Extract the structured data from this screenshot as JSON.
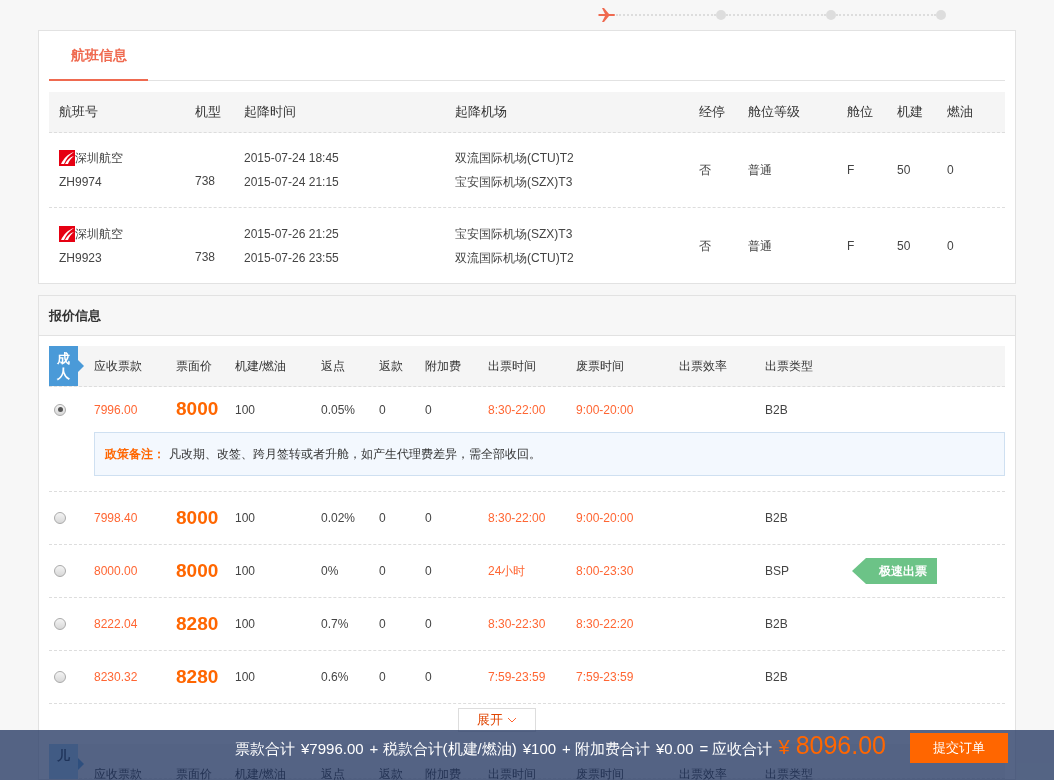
{
  "steps": [
    {
      "kind": "plane",
      "selected": true
    },
    {
      "kind": "dot",
      "selected": false
    },
    {
      "kind": "dot",
      "selected": false
    },
    {
      "kind": "dot",
      "selected": false
    }
  ],
  "flight_info": {
    "tab": "航班信息",
    "columns": [
      "航班号",
      "机型",
      "起降时间",
      "起降机场",
      "经停",
      "舱位等级",
      "舱位",
      "机建",
      "燃油"
    ],
    "rows": [
      {
        "airline": "深圳航空",
        "flight_no": "ZH9974",
        "aircraft": "738",
        "times": [
          "2015-07-24 18:45",
          "2015-07-24 21:15"
        ],
        "airports": [
          "双流国际机场(CTU)T2",
          "宝安国际机场(SZX)T3"
        ],
        "stop": "否",
        "cabin_class": "普通",
        "cabin": "F",
        "airport_fee": "50",
        "fuel": "0"
      },
      {
        "airline": "深圳航空",
        "flight_no": "ZH9923",
        "aircraft": "738",
        "times": [
          "2015-07-26 21:25",
          "2015-07-26 23:55"
        ],
        "airports": [
          "宝安国际机场(SZX)T3",
          "双流国际机场(CTU)T2"
        ],
        "stop": "否",
        "cabin_class": "普通",
        "cabin": "F",
        "airport_fee": "50",
        "fuel": "0"
      }
    ]
  },
  "quotes": {
    "title": "报价信息",
    "adult": {
      "badge": "成人",
      "columns": [
        "应收票款",
        "票面价",
        "机建/燃油",
        "返点",
        "返款",
        "附加费",
        "出票时间",
        "废票时间",
        "出票效率",
        "出票类型"
      ],
      "rows": [
        {
          "selected": true,
          "receivable": "7996.00",
          "face": "8000",
          "tax": "100",
          "rebate": "0.05%",
          "refund": "0",
          "surcharge": "0",
          "issue_time": "8:30-22:00",
          "void_time": "9:00-20:00",
          "type": "B2B",
          "note": {
            "label": "政策备注：",
            "text": "凡改期、改签、跨月签转或者升舱，如产生代理费差异，需全部收回。"
          }
        },
        {
          "selected": false,
          "receivable": "7998.40",
          "face": "8000",
          "tax": "100",
          "rebate": "0.02%",
          "refund": "0",
          "surcharge": "0",
          "issue_time": "8:30-22:00",
          "void_time": "9:00-20:00",
          "type": "B2B"
        },
        {
          "selected": false,
          "receivable": "8000.00",
          "face": "8000",
          "tax": "100",
          "rebate": "0%",
          "refund": "0",
          "surcharge": "0",
          "issue_time": "24小时",
          "void_time": "8:00-23:30",
          "type": "BSP",
          "tag": "极速出票"
        },
        {
          "selected": false,
          "receivable": "8222.04",
          "face": "8280",
          "tax": "100",
          "rebate": "0.7%",
          "refund": "0",
          "surcharge": "0",
          "issue_time": "8:30-22:30",
          "void_time": "8:30-22:20",
          "type": "B2B"
        },
        {
          "selected": false,
          "receivable": "8230.32",
          "face": "8280",
          "tax": "100",
          "rebate": "0.6%",
          "refund": "0",
          "surcharge": "0",
          "issue_time": "7:59-23:59",
          "void_time": "7:59-23:59",
          "type": "B2B"
        }
      ],
      "expand": "展开"
    },
    "child": {
      "badge": "儿",
      "columns": [
        "应收票款",
        "票面价",
        "机建/燃油",
        "返点",
        "返款",
        "附加费",
        "出票时间",
        "废票时间",
        "出票效率",
        "出票类型"
      ]
    }
  },
  "summary": {
    "items": [
      {
        "kind": "label",
        "text": "票款合计"
      },
      {
        "kind": "value",
        "text": "¥7996.00"
      },
      {
        "kind": "label",
        "text": "+ 税款合计(机建/燃油)"
      },
      {
        "kind": "value",
        "text": "¥100"
      },
      {
        "kind": "label",
        "text": "+ 附加费合计"
      },
      {
        "kind": "value",
        "text": "¥0.00"
      },
      {
        "kind": "label",
        "text": "= 应收合计"
      },
      {
        "kind": "currency",
        "text": "¥"
      },
      {
        "kind": "total",
        "text": "8096.00"
      }
    ],
    "submit": "提交订单"
  }
}
